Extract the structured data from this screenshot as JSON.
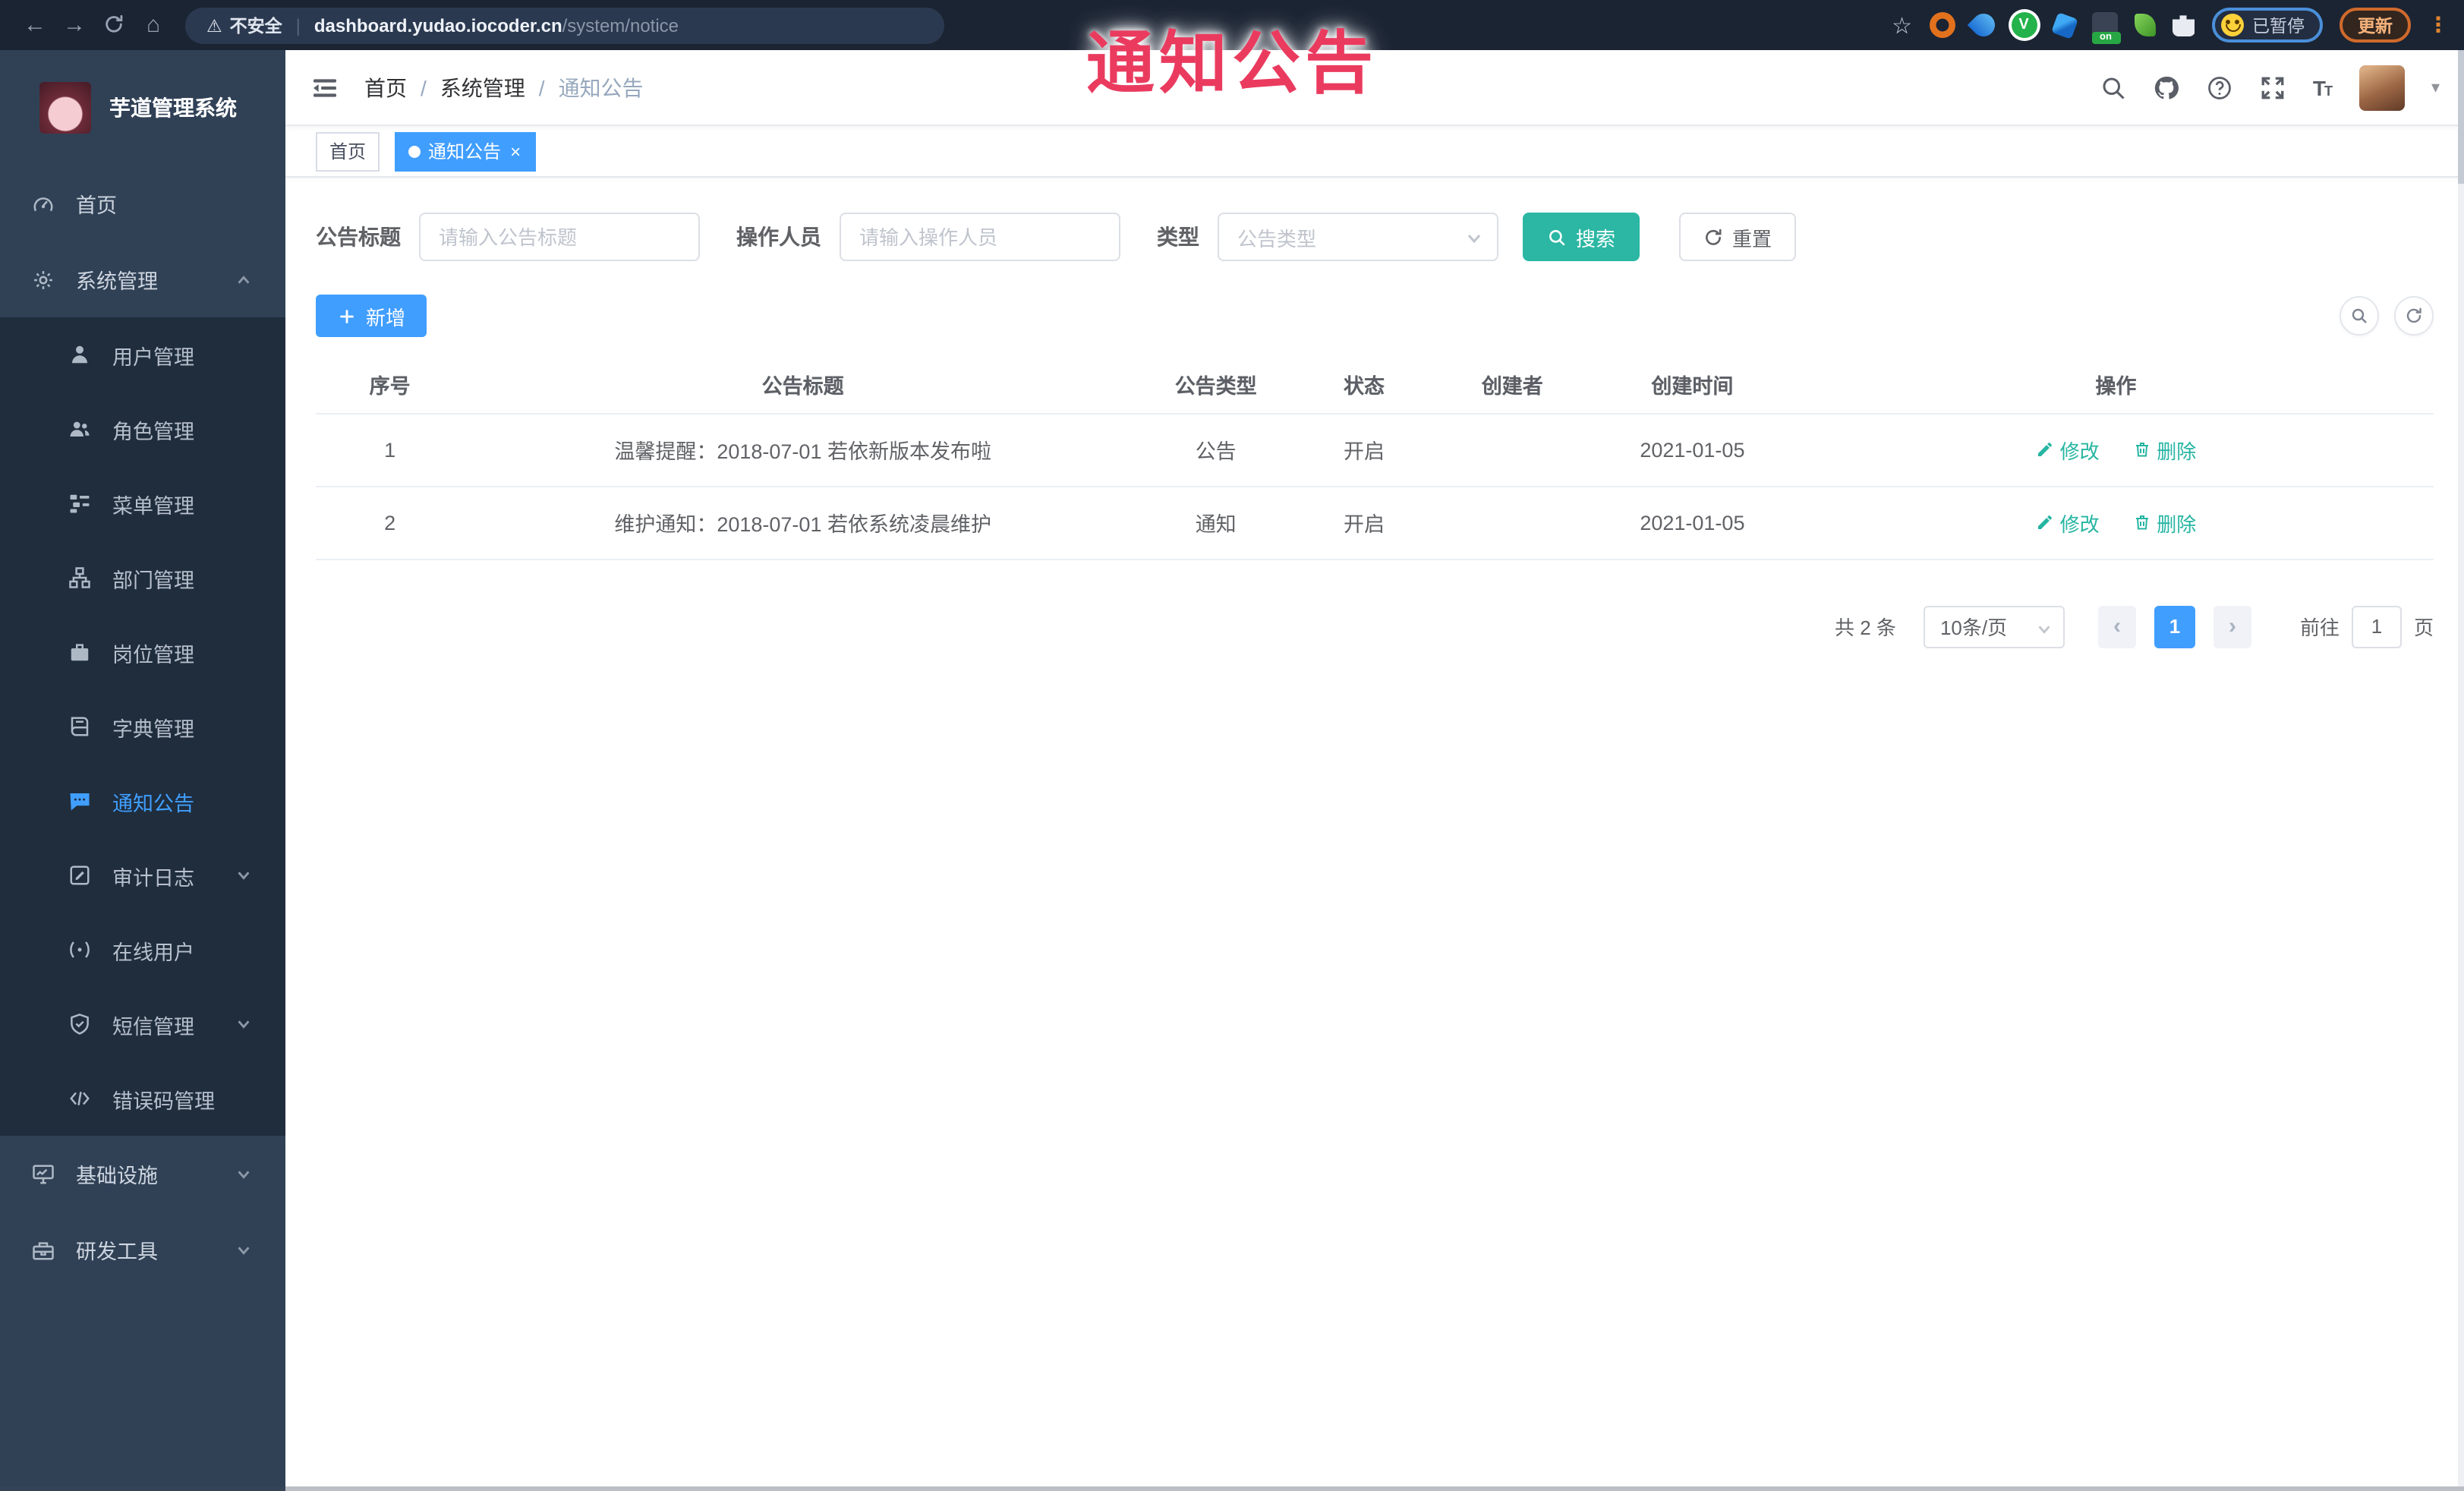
{
  "watermark_label": "通知公告",
  "browser": {
    "security_label": "不安全",
    "url_host": "dashboard.yudao.iocoder.cn",
    "url_path": "/system/notice",
    "extension_badge": "on",
    "paused_label": "已暂停",
    "update_label": "更新"
  },
  "sidebar": {
    "app_title": "芋道管理系统",
    "items": [
      {
        "label": "首页",
        "icon": "dashboard-icon",
        "level": 1,
        "active": false
      },
      {
        "label": "系统管理",
        "icon": "gear-icon",
        "level": 1,
        "expanded": true
      },
      {
        "label": "用户管理",
        "icon": "user-icon",
        "level": 2,
        "active": false
      },
      {
        "label": "角色管理",
        "icon": "roles-icon",
        "level": 2,
        "active": false
      },
      {
        "label": "菜单管理",
        "icon": "menu-tree-icon",
        "level": 2,
        "active": false
      },
      {
        "label": "部门管理",
        "icon": "org-tree-icon",
        "level": 2,
        "active": false
      },
      {
        "label": "岗位管理",
        "icon": "post-icon",
        "level": 2,
        "active": false
      },
      {
        "label": "字典管理",
        "icon": "dict-icon",
        "level": 2,
        "active": false
      },
      {
        "label": "通知公告",
        "icon": "notice-icon",
        "level": 2,
        "active": true
      },
      {
        "label": "审计日志",
        "icon": "audit-log-icon",
        "level": 2,
        "collapsible": true
      },
      {
        "label": "在线用户",
        "icon": "online-user-icon",
        "level": 2,
        "active": false
      },
      {
        "label": "短信管理",
        "icon": "sms-icon",
        "level": 2,
        "collapsible": true
      },
      {
        "label": "错误码管理",
        "icon": "error-code-icon",
        "level": 2,
        "active": false
      },
      {
        "label": "基础设施",
        "icon": "infra-icon",
        "level": 1,
        "collapsible": true
      },
      {
        "label": "研发工具",
        "icon": "devtools-icon",
        "level": 1,
        "collapsible": true
      }
    ]
  },
  "navbar": {
    "breadcrumb": [
      "首页",
      "系统管理",
      "通知公告"
    ]
  },
  "tags": [
    {
      "label": "首页",
      "active": false
    },
    {
      "label": "通知公告",
      "active": true
    }
  ],
  "filters": {
    "title_label": "公告标题",
    "title_placeholder": "请输入公告标题",
    "operator_label": "操作人员",
    "operator_placeholder": "请输入操作人员",
    "type_label": "类型",
    "type_placeholder": "公告类型",
    "search_label": "搜索",
    "reset_label": "重置"
  },
  "toolbar": {
    "add_label": "新增"
  },
  "table": {
    "columns": [
      "序号",
      "公告标题",
      "公告类型",
      "状态",
      "创建者",
      "创建时间",
      "操作"
    ],
    "rows": [
      {
        "no": "1",
        "title": "温馨提醒：2018-07-01 若依新版本发布啦",
        "type": "公告",
        "status": "开启",
        "creator": "",
        "create_time": "2021-01-05",
        "edit_label": "修改",
        "delete_label": "删除"
      },
      {
        "no": "2",
        "title": "维护通知：2018-07-01 若依系统凌晨维护",
        "type": "通知",
        "status": "开启",
        "creator": "",
        "create_time": "2021-01-05",
        "edit_label": "修改",
        "delete_label": "删除"
      }
    ]
  },
  "pagination": {
    "total_label": "共 2 条",
    "page_size_label": "10条/页",
    "current_page": "1",
    "goto_label": "前往",
    "goto_value": "1",
    "page_unit_label": "页"
  },
  "colors": {
    "accent_blue": "#409eff",
    "accent_teal": "#2bb7a3",
    "action_link_teal": "#26b5a2",
    "sidebar_bg": "#304156",
    "submenu_bg": "#1f2d3d",
    "chrome_bg": "#1b2433",
    "watermark_red": "#ea3b5f"
  }
}
